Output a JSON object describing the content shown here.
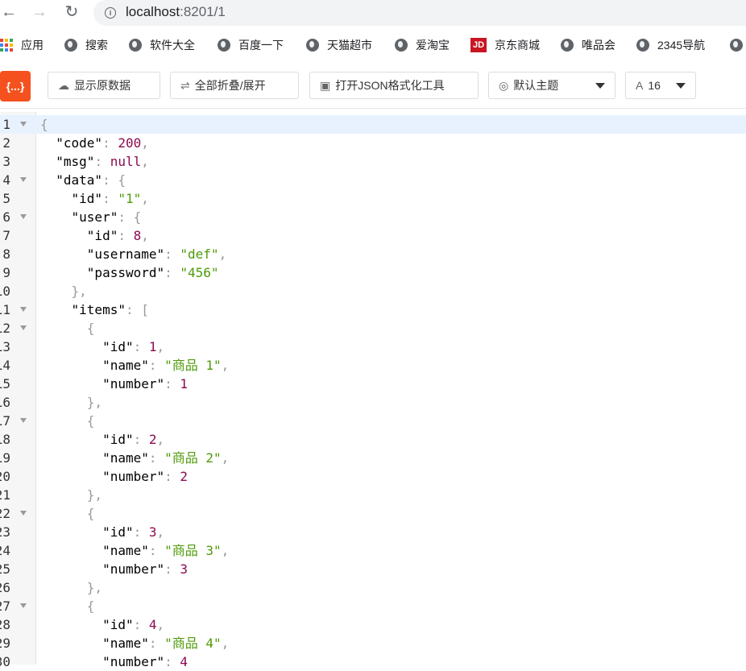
{
  "browser": {
    "url_host": "localhost",
    "url_rest": ":8201/1",
    "bookmarks": [
      "应用",
      "搜索",
      "软件大全",
      "百度一下",
      "天猫超市",
      "爱淘宝",
      "京东商城",
      "唯品会",
      "2345导航"
    ],
    "jd_badge": "JD"
  },
  "toolbar": {
    "logo": "{...}",
    "raw_label": "显示原数据",
    "fold_label": "全部折叠/展开",
    "json_tool_label": "打开JSON格式化工具",
    "theme_label": "默认主题",
    "font_size_value": "16"
  },
  "editor": {
    "lines": [
      {
        "num": "1",
        "fold": true
      },
      {
        "num": "2",
        "fold": false
      },
      {
        "num": "3",
        "fold": false
      },
      {
        "num": "4",
        "fold": true
      },
      {
        "num": "5",
        "fold": false
      },
      {
        "num": "6",
        "fold": true
      },
      {
        "num": "7",
        "fold": false
      },
      {
        "num": "8",
        "fold": false
      },
      {
        "num": "9",
        "fold": false
      },
      {
        "num": "10",
        "fold": false
      },
      {
        "num": "11",
        "fold": true
      },
      {
        "num": "12",
        "fold": true
      },
      {
        "num": "13",
        "fold": false
      },
      {
        "num": "14",
        "fold": false
      },
      {
        "num": "15",
        "fold": false
      },
      {
        "num": "16",
        "fold": false
      },
      {
        "num": "17",
        "fold": true
      },
      {
        "num": "18",
        "fold": false
      },
      {
        "num": "19",
        "fold": false
      },
      {
        "num": "20",
        "fold": false
      },
      {
        "num": "21",
        "fold": false
      },
      {
        "num": "22",
        "fold": true
      },
      {
        "num": "23",
        "fold": false
      },
      {
        "num": "24",
        "fold": false
      },
      {
        "num": "25",
        "fold": false
      },
      {
        "num": "26",
        "fold": false
      },
      {
        "num": "27",
        "fold": true
      },
      {
        "num": "28",
        "fold": false
      },
      {
        "num": "29",
        "fold": false
      },
      {
        "num": "30",
        "fold": false
      }
    ],
    "tokens": {
      "l1": [
        "{"
      ],
      "l2": [
        "  ",
        "\"code\"",
        ": ",
        "200",
        ","
      ],
      "l3": [
        "  ",
        "\"msg\"",
        ": ",
        "null",
        ","
      ],
      "l4": [
        "  ",
        "\"data\"",
        ": {"
      ],
      "l5": [
        "    ",
        "\"id\"",
        ": ",
        "\"1\"",
        ","
      ],
      "l6": [
        "    ",
        "\"user\"",
        ": {"
      ],
      "l7": [
        "      ",
        "\"id\"",
        ": ",
        "8",
        ","
      ],
      "l8": [
        "      ",
        "\"username\"",
        ": ",
        "\"def\"",
        ","
      ],
      "l9": [
        "      ",
        "\"password\"",
        ": ",
        "\"456\""
      ],
      "l10": [
        "    ",
        "},"
      ],
      "l11": [
        "    ",
        "\"items\"",
        ": ["
      ],
      "l12": [
        "      ",
        "{"
      ],
      "l13": [
        "        ",
        "\"id\"",
        ": ",
        "1",
        ","
      ],
      "l14": [
        "        ",
        "\"name\"",
        ": ",
        "\"商品 1\"",
        ","
      ],
      "l15": [
        "        ",
        "\"number\"",
        ": ",
        "1"
      ],
      "l16": [
        "      ",
        "},"
      ],
      "l17": [
        "      ",
        "{"
      ],
      "l18": [
        "        ",
        "\"id\"",
        ": ",
        "2",
        ","
      ],
      "l19": [
        "        ",
        "\"name\"",
        ": ",
        "\"商品 2\"",
        ","
      ],
      "l20": [
        "        ",
        "\"number\"",
        ": ",
        "2"
      ],
      "l21": [
        "      ",
        "},"
      ],
      "l22": [
        "      ",
        "{"
      ],
      "l23": [
        "        ",
        "\"id\"",
        ": ",
        "3",
        ","
      ],
      "l24": [
        "        ",
        "\"name\"",
        ": ",
        "\"商品 3\"",
        ","
      ],
      "l25": [
        "        ",
        "\"number\"",
        ": ",
        "3"
      ],
      "l26": [
        "      ",
        "},"
      ],
      "l27": [
        "      ",
        "{"
      ],
      "l28": [
        "        ",
        "\"id\"",
        ": ",
        "4",
        ","
      ],
      "l29": [
        "        ",
        "\"name\"",
        ": ",
        "\"商品 4\"",
        ","
      ],
      "l30": [
        "        ",
        "\"number\"",
        ": ",
        "4"
      ]
    }
  },
  "colors": {
    "key": "#000000",
    "string": "#4e9a06",
    "number": "#8b0a50",
    "punct": "#999999",
    "logo_bg": "#f4511e"
  }
}
